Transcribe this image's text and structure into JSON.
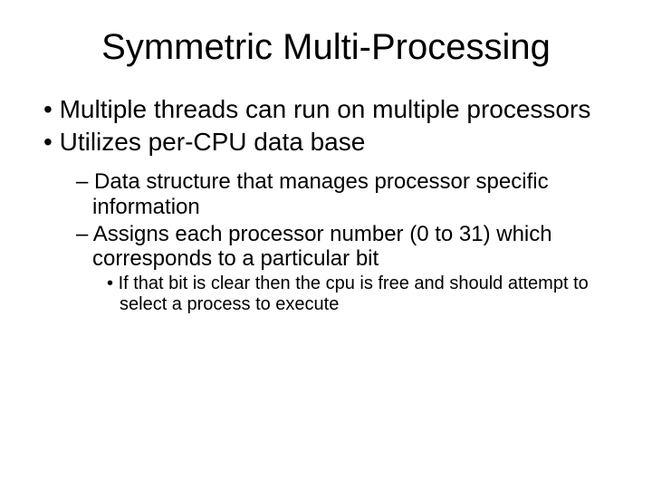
{
  "title": "Symmetric Multi-Processing",
  "bullets": {
    "b1": "Multiple threads can run on multiple processors",
    "b2": "Utilizes per-CPU data base",
    "b2_1": "Data structure that manages processor specific information",
    "b2_2": "Assigns each processor number (0 to 31) which corresponds to a particular bit",
    "b2_2_1": "If that bit is clear then the cpu is free and should attempt to select a process to execute"
  }
}
